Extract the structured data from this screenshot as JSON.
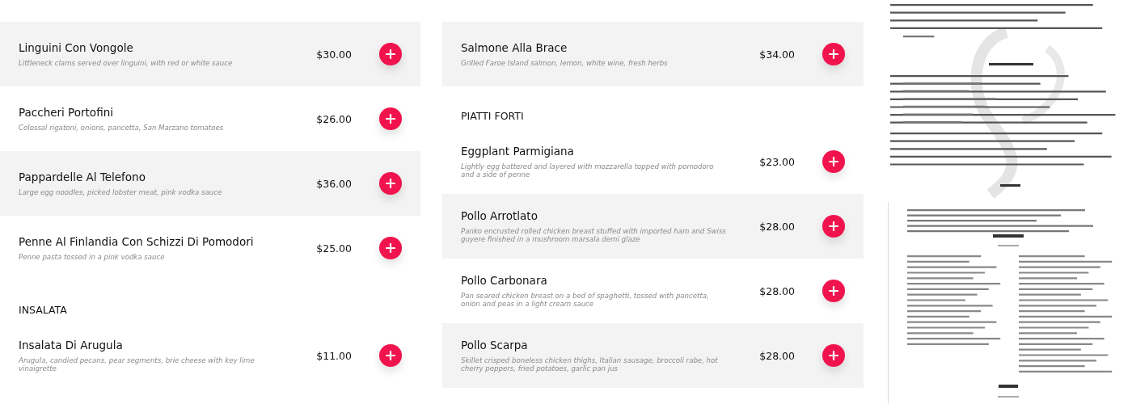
{
  "menu_columns": [
    {
      "blocks": [
        {
          "kind": "item",
          "shaded": true,
          "name": "Linguini Con Vongole",
          "description": "Littleneck clams served over linguini, with red or white sauce",
          "price": "$30.00"
        },
        {
          "kind": "item",
          "shaded": false,
          "name": "Paccheri Portofini",
          "description": "Colossal rigatoni, onions, pancetta, San Marzano tomatoes",
          "price": "$26.00"
        },
        {
          "kind": "item",
          "shaded": true,
          "name": "Pappardelle Al Telefono",
          "description": "Large egg noodles, picked lobster meat, pink vodka sauce",
          "price": "$36.00"
        },
        {
          "kind": "item",
          "shaded": false,
          "name": "Penne Al Finlandia Con Schizzi Di Pomodori",
          "description": "Penne pasta tossed in a pink vodka sauce",
          "price": "$25.00"
        },
        {
          "kind": "heading",
          "text": "INSALATA"
        },
        {
          "kind": "item",
          "shaded": false,
          "name": "Insalata Di Arugula",
          "description": "Arugula, candied pecans, pear segments, brie cheese with key lime vinaigrette",
          "price": "$11.00"
        }
      ]
    },
    {
      "blocks": [
        {
          "kind": "item",
          "shaded": true,
          "name": "Salmone Alla Brace",
          "description": "Grilled Faroe Island salmon, lemon, white wine, fresh herbs",
          "price": "$34.00"
        },
        {
          "kind": "heading",
          "text": "PIATTI FORTI"
        },
        {
          "kind": "item",
          "shaded": false,
          "name": "Eggplant Parmigiana",
          "description": "Lightly egg battered and layered with mozzarella topped with pomodoro and a side of penne",
          "price": "$23.00"
        },
        {
          "kind": "item",
          "shaded": true,
          "name": "Pollo Arrotlato",
          "description": "Panko encrusted rolled chicken breast stuffed with imported ham and Swiss guyere finished in a mushroom marsala demi glaze",
          "price": "$28.00"
        },
        {
          "kind": "item",
          "shaded": false,
          "name": "Pollo Carbonara",
          "description": "Pan seared chicken breast on a bed of spaghetti, tossed with pancetta, onion and peas in a light cream sauce",
          "price": "$28.00"
        },
        {
          "kind": "item",
          "shaded": true,
          "name": "Pollo Scarpa",
          "description": "Skillet crisped boneless chicken thighs, Italian sausage, broccoli rabe, hot cherry peppers, fried potatoes, garlic pan jus",
          "price": "$28.00"
        }
      ]
    }
  ]
}
